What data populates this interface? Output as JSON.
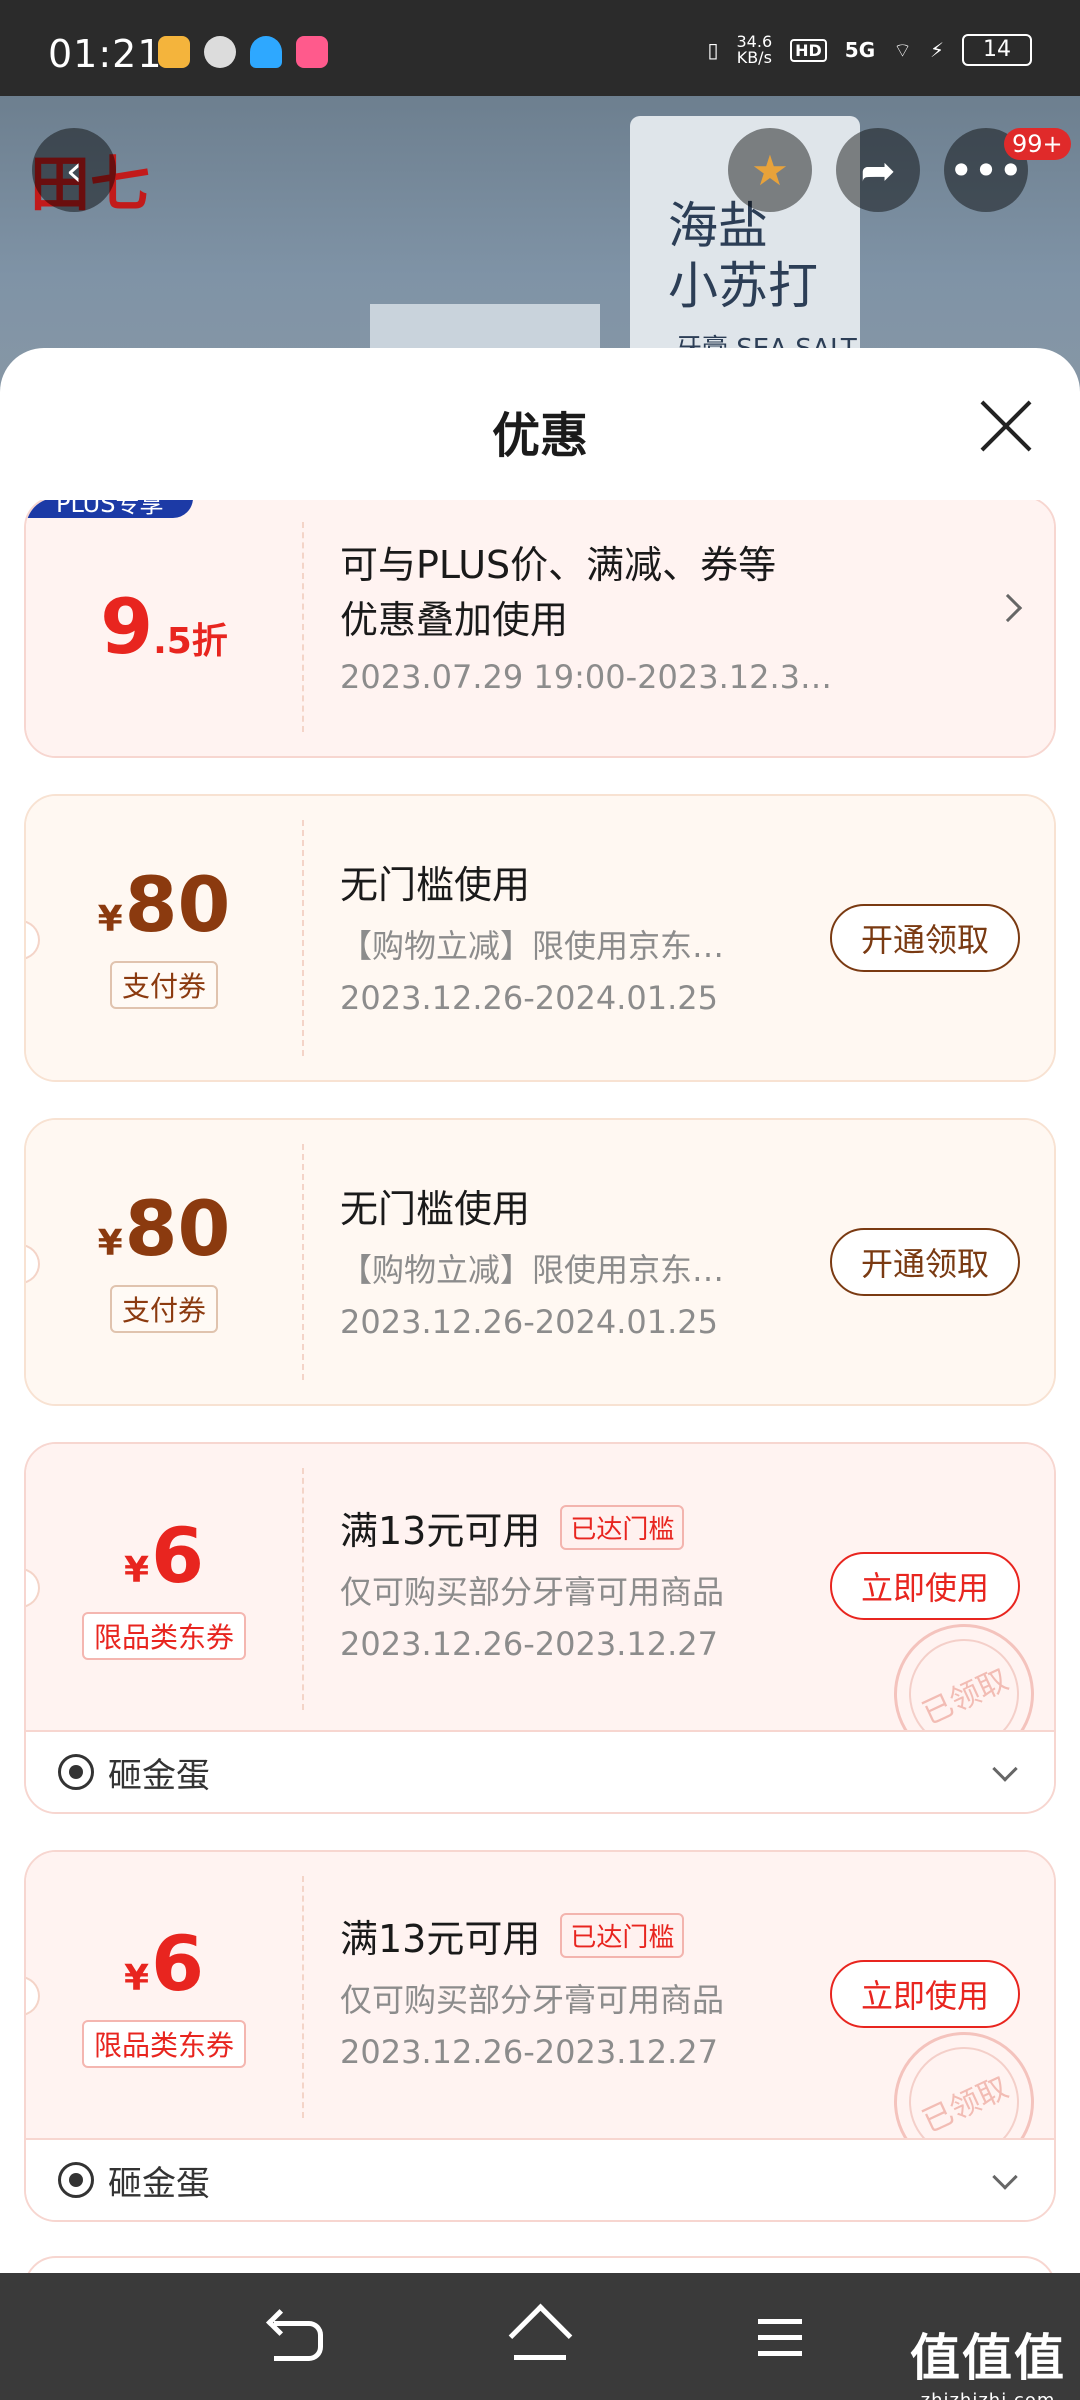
{
  "status_bar": {
    "time": "01:21",
    "net_speed_value": "34.6",
    "net_speed_unit": "KB/s",
    "hd": "HD",
    "signal": "5G",
    "battery": "14"
  },
  "header": {
    "more_badge": "99+"
  },
  "sheet": {
    "title": "优惠"
  },
  "coupons": [
    {
      "tag": "PLUS专享",
      "amount_num": "9",
      "amount_unit": ".5折",
      "title": "可与PLUS价、满减、券等",
      "title2": "优惠叠加使用",
      "date": "2023.07.29 19:00-2023.12.3…"
    },
    {
      "amount_symbol": "¥",
      "amount_num": "80",
      "type": "支付券",
      "title": "无门槛使用",
      "desc": "【购物立减】限使用京东…",
      "date": "2023.12.26-2024.01.25",
      "action": "开通领取"
    },
    {
      "amount_symbol": "¥",
      "amount_num": "80",
      "type": "支付券",
      "title": "无门槛使用",
      "desc": "【购物立减】限使用京东…",
      "date": "2023.12.26-2024.01.25",
      "action": "开通领取"
    },
    {
      "amount_symbol": "¥",
      "amount_num": "6",
      "type": "限品类东券",
      "title": "满13元可用",
      "badge": "已达门槛",
      "desc": "仅可购买部分牙膏可用商品",
      "date": "2023.12.26-2023.12.27",
      "action": "立即使用",
      "stamp": "已领取",
      "extra": "砸金蛋"
    },
    {
      "amount_symbol": "¥",
      "amount_num": "6",
      "type": "限品类东券",
      "title": "满13元可用",
      "badge": "已达门槛",
      "desc": "仅可购买部分牙膏可用商品",
      "date": "2023.12.26-2023.12.27",
      "action": "立即使用",
      "stamp": "已领取",
      "extra": "砸金蛋"
    }
  ],
  "watermark": {
    "main": "值值值",
    "sub": "zhizhizhi.com"
  },
  "colors": {
    "accent_red": "#e8251f",
    "brown": "#8b3a0f",
    "plus_blue": "#1c3aa6"
  }
}
